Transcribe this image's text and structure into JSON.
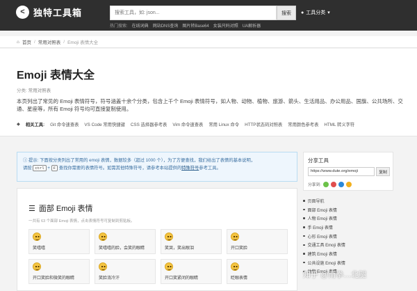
{
  "header": {
    "logo_mark": "<",
    "site_name": "独特工具箱",
    "search_placeholder": "搜索工具，如: json...",
    "search_button": "搜索",
    "tools_category": "工具分类",
    "hot_label": "热门搜索:",
    "hot_links": [
      "在线词典",
      "网站DNS查询",
      "图片转Base64",
      "女装尺码对照",
      "UA解析器"
    ]
  },
  "breadcrumb": {
    "home": "首页",
    "parent": "常用对照表",
    "current": "Emoji 表情大全",
    "sep": "/"
  },
  "page": {
    "title": "Emoji 表情大全",
    "category_label": "分类:",
    "category": "常用对照表",
    "description": "本页列出了常见的 Emoji 表情符号，符号涵盖十余个分类，包含上千个 Emoji 表情符号，如人物、动物、植物、旅游、箭头、生活用品、办公用品、国旗、公共场所、交通、星座等，所有 Emoji 符号均可直接复制使用。",
    "related_label": "相关工具:",
    "related_tools": [
      "Git 命令速查表",
      "VS Code 常用快捷键",
      "CSS 选择器参考表",
      "Vim 命令速查表",
      "常用 Linux 命令",
      "HTTP状态码对照表",
      "常用颜色参考表",
      "HTML 转义字符"
    ]
  },
  "tip": {
    "line1": "提示: 下面按分类列出了常用的 emoji 表情，数据较多（超过 1000 个），为了方便查找，我们给出了表情的基本说明，",
    "line2_pre": "请按",
    "key1": "ctrl",
    "plus": "+",
    "key2": "F",
    "line2_mid": "查找你需要的表情符号。如需其他特殊符号，请参考本站提供的",
    "link": "特殊符号",
    "line2_post": "参考工具。"
  },
  "emoji_section": {
    "icon": "list-icon",
    "title": "面部 Emoji 表情",
    "subtitle": "一共有 63 个面部 Emoji 表情，点击表情符号可复制到剪贴板。",
    "items": [
      {
        "name": "笑嘻嘻"
      },
      {
        "name": "笑嘻嘻的脸，会笑的眼睛"
      },
      {
        "name": "笑哭，笑出眼泪"
      },
      {
        "name": "开口笑脸"
      },
      {
        "name": "开口笑脸和微笑的眼睛"
      },
      {
        "name": "笑脸淌冷汗"
      },
      {
        "name": "开口笑紧闭的眼睛"
      },
      {
        "name": "眨眼表情"
      }
    ]
  },
  "share": {
    "title": "分享工具",
    "url": "https://www.dute.org/emoji",
    "copy_button": "复制",
    "share_to": "分享到:",
    "colors": [
      "#6cc24a",
      "#e04e4e",
      "#2b88d9",
      "#f2b01e"
    ]
  },
  "nav": {
    "title": "页面导航",
    "items": [
      "面部 Emoji 表情",
      "人物 Emoji 表情",
      "手 Emoji 表情",
      "心形 Emoji 表情",
      "交通工具 Emoji 表情",
      "建筑 Emoji 表情",
      "公共设施 Emoji 表情",
      "动物 Emoji 表情"
    ]
  },
  "watermark": "知乎 @南拳…北腿"
}
